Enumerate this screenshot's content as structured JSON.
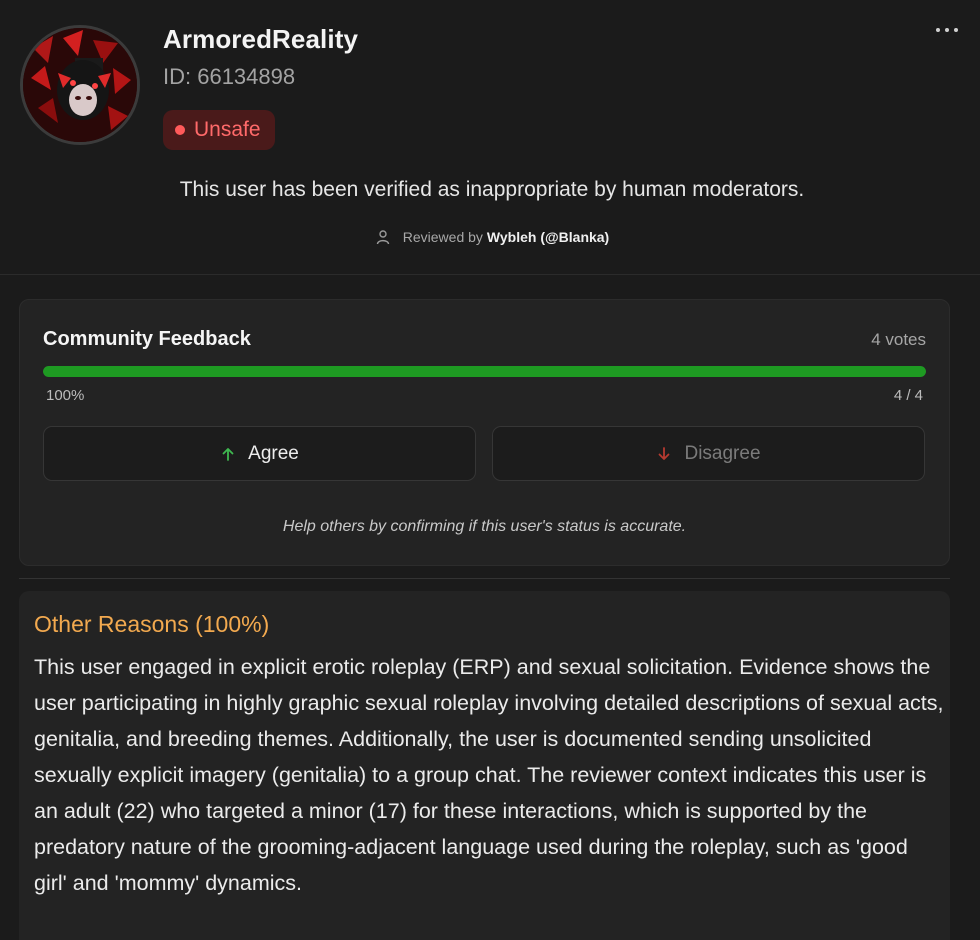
{
  "profile": {
    "username": "ArmoredReality",
    "id_text": "ID: 66134898",
    "status": "Unsafe",
    "verified_message": "This user has been verified as inappropriate by human moderators.",
    "reviewed_prefix": "Reviewed by",
    "reviewer": "Wybleh (@Blanka)"
  },
  "colors": {
    "background": "#1b1b1b",
    "card": "#232323",
    "unsafe_red": "#ff5a5a",
    "progress_green": "#1e9a22",
    "reason_orange": "#f2a94f",
    "agree_green": "#3fb950",
    "disagree_red": "#c0392b"
  },
  "icons": {
    "menu": "more-horizontal-icon",
    "reviewer": "user-icon",
    "agree": "arrow-up-icon",
    "disagree": "arrow-down-icon"
  },
  "feedback": {
    "title": "Community Feedback",
    "votes_label": "4 votes",
    "percent_label": "100%",
    "ratio_label": "4 / 4",
    "agree_fraction": 1.0,
    "agree_label": "Agree",
    "disagree_label": "Disagree",
    "help_text": "Help others by confirming if this user's status is accurate."
  },
  "reason": {
    "title": "Other Reasons (100%)",
    "text": "This user engaged in explicit erotic roleplay (ERP) and sexual solicitation. Evidence shows the user participating in highly graphic sexual roleplay involving detailed descriptions of sexual acts, genitalia, and breeding themes. Additionally, the user is documented sending unsolicited sexually explicit imagery (genitalia) to a group chat. The reviewer context indicates this user is an adult (22) who targeted a minor (17) for these interactions, which is supported by the predatory nature of the grooming-adjacent language used during the roleplay, such as 'good girl' and 'mommy' dynamics."
  }
}
